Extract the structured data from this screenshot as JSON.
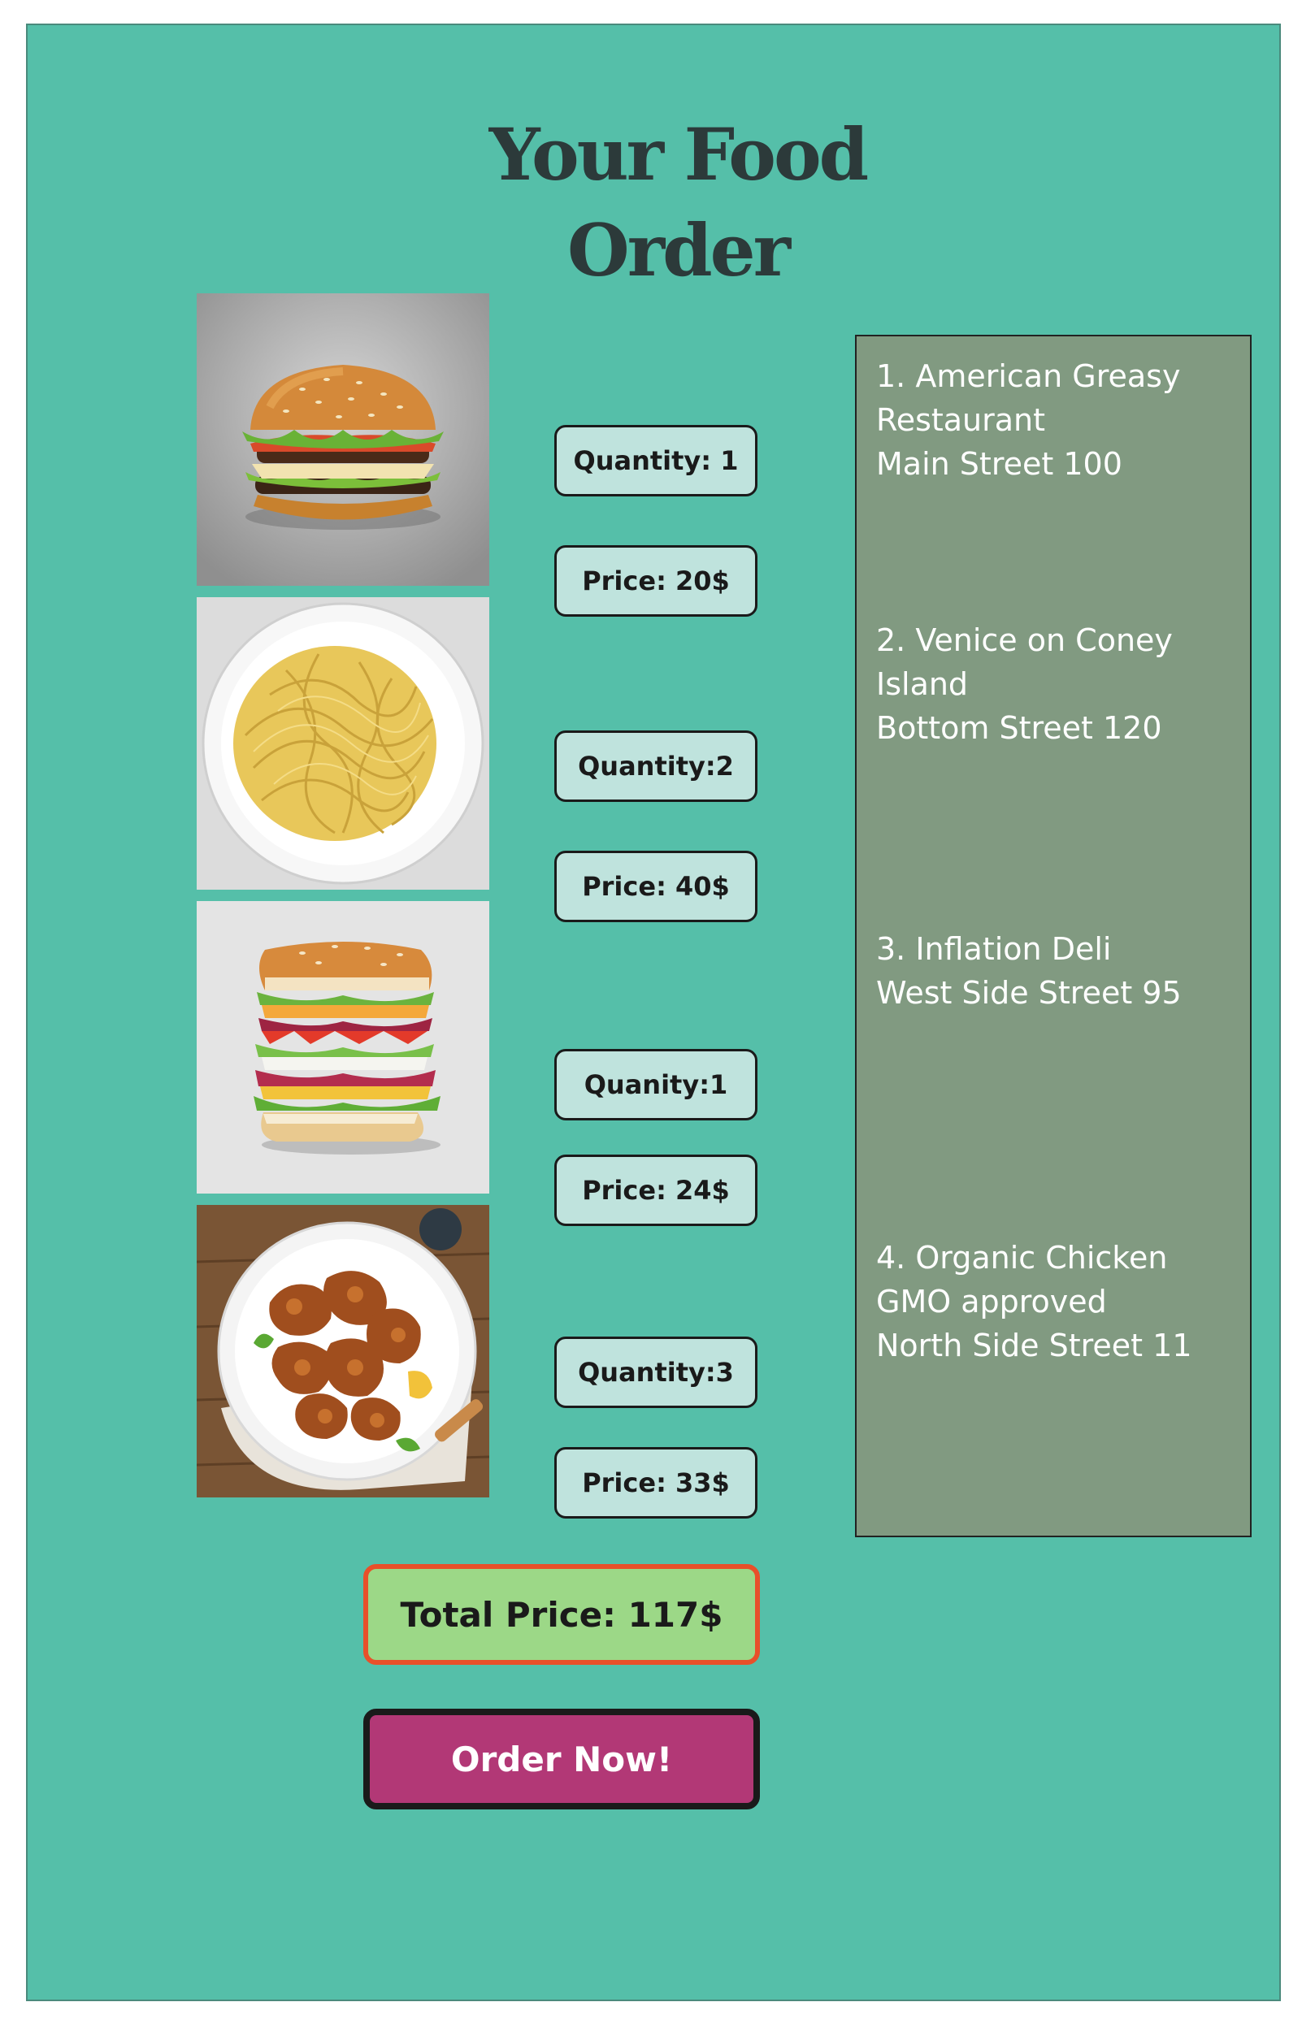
{
  "page": {
    "title_line1": "Your Food",
    "title_line2": "Order"
  },
  "items": [
    {
      "image": "burger-image",
      "quantity": "Quantity: 1",
      "price": "Price: 20$"
    },
    {
      "image": "spaghetti-image",
      "quantity": "Quantity:2",
      "price": "Price: 40$"
    },
    {
      "image": "sandwich-image",
      "quantity": "Quanity:1",
      "price": "Price: 24$"
    },
    {
      "image": "fried-chicken-image",
      "quantity": "Quantity:3",
      "price": "Price: 33$"
    }
  ],
  "restaurants": [
    {
      "line1": "1. American Greasy",
      "line2": "Restaurant",
      "line3": "Main Street 100"
    },
    {
      "line1": "2. Venice on Coney",
      "line2": "Island",
      "line3": "Bottom Street 120"
    },
    {
      "line1": "3. Inflation Deli",
      "line2": "West Side Street 95"
    },
    {
      "line1": "4. Organic Chicken",
      "line2": "GMO approved",
      "line3": "North Side Street 11"
    }
  ],
  "total": {
    "label": "Total Price: 117$"
  },
  "order_button": {
    "label": "Order Now!"
  },
  "colors": {
    "background": "#55bfa9",
    "pill": "#bfe3dd",
    "restaurant_panel": "#819a81",
    "total_bg": "#9cd887",
    "total_border": "#e8502a",
    "order_button": "#b23876"
  }
}
